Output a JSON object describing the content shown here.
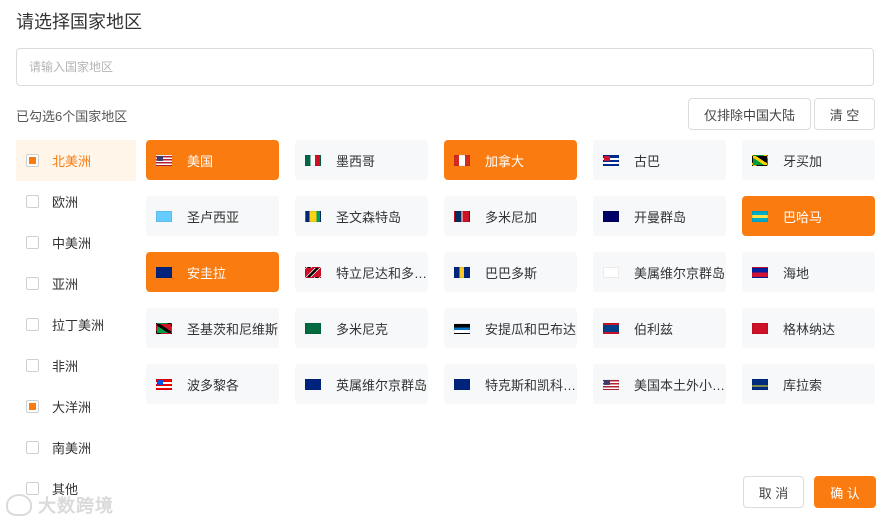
{
  "title": "请选择国家地区",
  "search": {
    "placeholder": "请输入国家地区",
    "value": ""
  },
  "selected_count_text": "已勾选6个国家地区",
  "buttons": {
    "exclude_china": "仅排除中国大陆",
    "clear": "清 空",
    "cancel": "取 消",
    "confirm": "确 认"
  },
  "continents": [
    {
      "label": "北美洲",
      "state": "partial",
      "active": true
    },
    {
      "label": "欧洲",
      "state": "unchecked",
      "active": false
    },
    {
      "label": "中美洲",
      "state": "unchecked",
      "active": false
    },
    {
      "label": "亚洲",
      "state": "unchecked",
      "active": false
    },
    {
      "label": "拉丁美洲",
      "state": "unchecked",
      "active": false
    },
    {
      "label": "非洲",
      "state": "unchecked",
      "active": false
    },
    {
      "label": "大洋洲",
      "state": "partial",
      "active": false
    },
    {
      "label": "南美洲",
      "state": "unchecked",
      "active": false
    },
    {
      "label": "其他",
      "state": "unchecked",
      "active": false
    }
  ],
  "countries": [
    {
      "name": "美国",
      "selected": true,
      "flag": "us-flag-icon",
      "flag_css": "repeating-linear-gradient(180deg,#b22234 0 1.5px,#fff 1.5px 3px)",
      "canton": "#3c3b6e"
    },
    {
      "name": "墨西哥",
      "selected": false,
      "flag": "mexico-flag-icon",
      "flag_css": "linear-gradient(90deg,#006847 33%,#fff 33% 66%,#ce1126 66%)"
    },
    {
      "name": "加拿大",
      "selected": true,
      "flag": "canada-flag-icon",
      "flag_css": "linear-gradient(90deg,#d52b1e 28%,#fff 28% 72%,#d52b1e 72%)"
    },
    {
      "name": "古巴",
      "selected": false,
      "flag": "cuba-flag-icon",
      "flag_css": "repeating-linear-gradient(180deg,#002a8f 0 2px,#fff 2px 4px)",
      "canton": "#cf142b"
    },
    {
      "name": "牙买加",
      "selected": false,
      "flag": "jamaica-flag-icon",
      "flag_css": "linear-gradient(33deg,#009b3a 40%,#fed100 40% 60%,#000 60%)"
    },
    {
      "name": "圣卢西亚",
      "selected": false,
      "flag": "saint-lucia-flag-icon",
      "flag_css": "linear-gradient(180deg,#66ccff,#66ccff)"
    },
    {
      "name": "圣文森特岛",
      "selected": false,
      "flag": "saint-vincent-flag-icon",
      "flag_css": "linear-gradient(90deg,#002674 25%,#fcd116 25% 75%,#009e60 75%)"
    },
    {
      "name": "多米尼加",
      "selected": false,
      "flag": "dominican-republic-flag-icon",
      "flag_css": "linear-gradient(90deg,#002d62 45%,#fff 45% 55%,#ce1126 55%)"
    },
    {
      "name": "开曼群岛",
      "selected": false,
      "flag": "cayman-islands-flag-icon",
      "flag_css": "linear-gradient(180deg,#000066,#000066)"
    },
    {
      "name": "巴哈马",
      "selected": true,
      "flag": "bahamas-flag-icon",
      "flag_css": "linear-gradient(180deg,#00abc9 33%,#fae042 33% 66%,#00abc9 66%)"
    },
    {
      "name": "安圭拉",
      "selected": true,
      "flag": "anguilla-flag-icon",
      "flag_css": "linear-gradient(180deg,#00247d,#00247d)"
    },
    {
      "name": "特立尼达和多巴哥",
      "selected": false,
      "flag": "trinidad-flag-icon",
      "flag_css": "linear-gradient(135deg,#ce1126 38%,#fff 38% 42%,#000 42% 58%,#fff 58% 62%,#ce1126 62%)"
    },
    {
      "name": "巴巴多斯",
      "selected": false,
      "flag": "barbados-flag-icon",
      "flag_css": "linear-gradient(90deg,#00267f 33%,#ffc726 33% 66%,#00267f 66%)"
    },
    {
      "name": "美属维尔京群岛",
      "selected": false,
      "flag": "us-virgin-islands-flag-icon",
      "flag_css": "linear-gradient(180deg,#fff,#fff)"
    },
    {
      "name": "海地",
      "selected": false,
      "flag": "haiti-flag-icon",
      "flag_css": "linear-gradient(180deg,#00209f 50%,#d21034 50%)"
    },
    {
      "name": "圣基茨和尼维斯",
      "selected": false,
      "flag": "saint-kitts-flag-icon",
      "flag_css": "linear-gradient(33deg,#009e49 40%,#000 40% 60%,#ce1126 60%)"
    },
    {
      "name": "多米尼克",
      "selected": false,
      "flag": "dominica-flag-icon",
      "flag_css": "linear-gradient(180deg,#006b3f,#006b3f)"
    },
    {
      "name": "安提瓜和巴布达",
      "selected": false,
      "flag": "antigua-flag-icon",
      "flag_css": "linear-gradient(180deg,#000 40%,#0072c6 40% 65%,#fff 65%)"
    },
    {
      "name": "伯利兹",
      "selected": false,
      "flag": "belize-flag-icon",
      "flag_css": "linear-gradient(180deg,#ce1126 12%,#003f87 12% 88%,#ce1126 88%)"
    },
    {
      "name": "格林纳达",
      "selected": false,
      "flag": "grenada-flag-icon",
      "flag_css": "linear-gradient(180deg,#ce1126,#ce1126)"
    },
    {
      "name": "波多黎各",
      "selected": false,
      "flag": "puerto-rico-flag-icon",
      "flag_css": "repeating-linear-gradient(180deg,#ed0000 0 2px,#fff 2px 4px)",
      "canton": "#0050f0"
    },
    {
      "name": "英属维尔京群岛",
      "selected": false,
      "flag": "british-virgin-islands-flag-icon",
      "flag_css": "linear-gradient(180deg,#00247d,#00247d)"
    },
    {
      "name": "特克斯和凯科斯群岛",
      "selected": false,
      "flag": "turks-caicos-flag-icon",
      "flag_css": "linear-gradient(180deg,#00247d,#00247d)"
    },
    {
      "name": "美国本土外小岛屿",
      "selected": false,
      "flag": "us-outlying-islands-flag-icon",
      "flag_css": "repeating-linear-gradient(180deg,#b22234 0 1.5px,#fff 1.5px 3px)",
      "canton": "#3c3b6e"
    },
    {
      "name": "库拉索",
      "selected": false,
      "flag": "curacao-flag-icon",
      "flag_css": "linear-gradient(180deg,#002b7f 60%,#f9e814 60% 72%,#002b7f 72%)"
    }
  ],
  "watermark": "大数跨境",
  "colors": {
    "accent": "#fa7b10",
    "active_bg": "#fff6e9",
    "tile_bg": "#f7f8fa"
  }
}
